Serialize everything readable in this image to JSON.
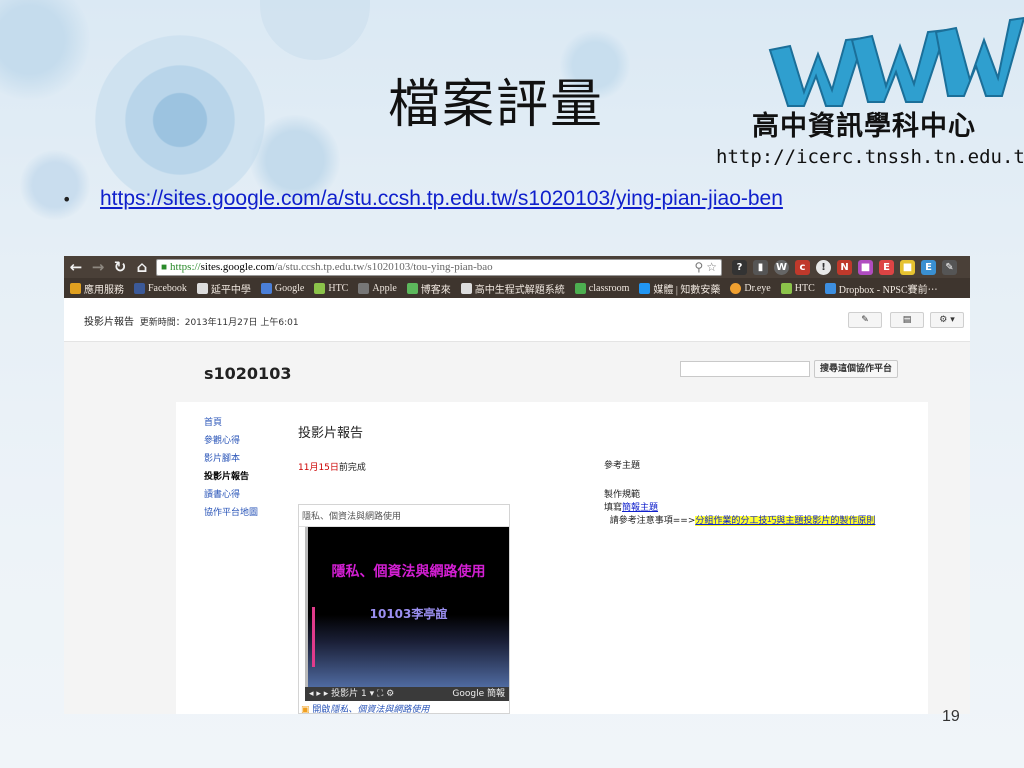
{
  "slide": {
    "title": "檔案評量",
    "logo_text": "高中資訊學科中心",
    "logo_url": "http://icerc.tnssh.tn.edu.tw",
    "bullet_link": "https://sites.google.com/a/stu.ccsh.tp.edu.tw/s1020103/ying-pian-jiao-ben",
    "page_number": "19"
  },
  "browser": {
    "url_https": "https://",
    "url_host": "sites.google.com",
    "url_rest": "/a/stu.ccsh.tp.edu.tw/s1020103/tou-ying-pian-bao",
    "bookmarks": [
      "應用服務",
      "Facebook",
      "延平中學",
      "Google",
      "HTC",
      "Apple",
      "博客來",
      "高中生程式解題系統",
      "classroom",
      "媒體 | 知數安藥",
      "Dr.eye",
      "HTC",
      "Dropbox - NPSC賽前⋯"
    ]
  },
  "site": {
    "bar_page_label": "投影片報告",
    "bar_updated": "更新時間：2013年11月27日 上午6:01",
    "site_name": "s1020103",
    "search_button": "搜尋這個協作平台",
    "nav_items": [
      "首頁",
      "參觀心得",
      "影片腳本",
      "投影片報告",
      "讀書心得",
      "協作平台地圖"
    ],
    "active_nav": "投影片報告",
    "page_heading": "投影片報告",
    "due_date": "11月15日",
    "due_suffix": "前完成",
    "embed_title": "隱私、個資法與網路使用",
    "thumb_title": "隱私、個資法與網路使用",
    "thumb_subtitle": "10103李亭誼",
    "player_label": "投影片 1",
    "player_brand": "Google 簡報",
    "open_link_prefix": "開啟",
    "open_link_doc": "隱私、個資法與網路使用",
    "ref_topic": "參考主題",
    "ref_rules": "製作規範",
    "ref_fill": "填寫",
    "ref_fill_link": "簡報主題",
    "ref_note": "請參考注意事項==>",
    "ref_note_link": "分組作業的分工技巧與主題投影片的製作原則"
  },
  "colors": {
    "link": "#1020cc",
    "nav_link": "#2a55b8",
    "due_red": "#cc0000",
    "highlight": "#ffff33",
    "thumb_title": "#d31fd3"
  }
}
